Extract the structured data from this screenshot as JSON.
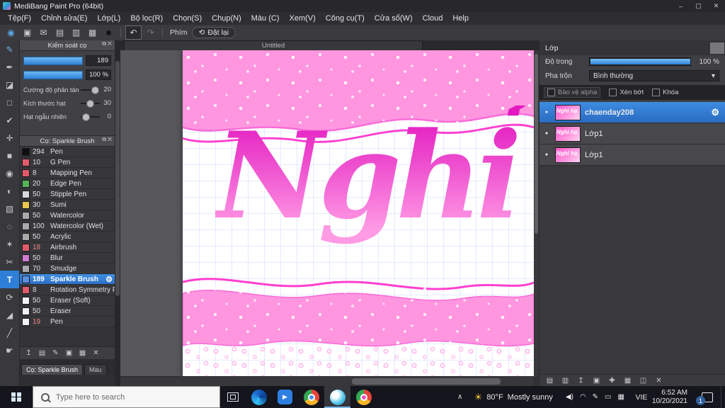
{
  "titlebar": {
    "title": "MediBang Paint Pro (64bit)"
  },
  "window": {
    "min": "–",
    "max": "▢",
    "close": "✕"
  },
  "menubar": {
    "items": [
      "Tệp(F)",
      "Chỉnh sửa(E)",
      "Lớp(L)",
      "Bộ lọc(R)",
      "Chọn(S)",
      "Chụp(N)",
      "Màu (C)",
      "Xem(V)",
      "Công cụ(T)",
      "Cửa sổ(W)",
      "Cloud",
      "Help"
    ]
  },
  "toolbar": {
    "phim": "Phím",
    "dat_lai": "Đặt lại",
    "icons": [
      {
        "name": "brush-preset-icon",
        "glyph": "◉"
      },
      {
        "name": "save-icon",
        "glyph": "▣"
      },
      {
        "name": "comment-icon",
        "glyph": "✉"
      },
      {
        "name": "copy-icon",
        "glyph": "▤"
      },
      {
        "name": "document-icon",
        "glyph": "▥"
      },
      {
        "name": "grid-icon",
        "glyph": "▦"
      },
      {
        "name": "swatch-icon",
        "glyph": "■"
      }
    ]
  },
  "icons": {
    "gear": "⚙",
    "undo": "↶",
    "redo": "↷",
    "reset": "⟲",
    "chevron_up": "∧",
    "sun": "☀",
    "dot": "●"
  },
  "tools": {
    "items": [
      {
        "name": "brush-tool",
        "glyph": "✎"
      },
      {
        "name": "pen-tool",
        "glyph": "✒"
      },
      {
        "name": "eraser-tool",
        "glyph": "◪"
      },
      {
        "name": "marquee-tool",
        "glyph": "□"
      },
      {
        "name": "apply-tool",
        "glyph": "✔"
      },
      {
        "name": "move-tool",
        "glyph": "✛"
      },
      {
        "name": "shape-tool",
        "glyph": "■"
      },
      {
        "name": "bucket-tool",
        "glyph": "◉"
      },
      {
        "name": "gradient-tool",
        "glyph": "◐"
      },
      {
        "name": "select-rect-tool",
        "glyph": "▧"
      },
      {
        "name": "lasso-tool",
        "glyph": "◌"
      },
      {
        "name": "magic-wand-tool",
        "glyph": "✶"
      },
      {
        "name": "scissors-tool",
        "glyph": "✂"
      },
      {
        "name": "text-tool",
        "glyph": "T"
      },
      {
        "name": "rotate-tool",
        "glyph": "⟳"
      },
      {
        "name": "eyedropper-tool",
        "glyph": "◢"
      },
      {
        "name": "divide-tool",
        "glyph": "╱"
      },
      {
        "name": "hand-tool",
        "glyph": "☛"
      }
    ]
  },
  "brush_control": {
    "title": "Kiểm soát cọ",
    "size": "189",
    "opacity": "100 %",
    "p1_label": "Cường độ phân tán",
    "p1_value": "20",
    "p2_label": "Kích thước hạt",
    "p2_value": "30",
    "p3_label": "Hạt ngẫu nhiên",
    "p3_value": "0"
  },
  "brush_panel": {
    "title": "Cọ: Sparkle Brush",
    "tab_brush": "Cọ: Sparkle Brush",
    "tab_color": "Màu",
    "iconbar": [
      {
        "name": "reorder-brush-icon",
        "glyph": "↥"
      },
      {
        "name": "add-brush-icon",
        "glyph": "▤"
      },
      {
        "name": "edit-brush-icon",
        "glyph": "✎"
      },
      {
        "name": "duplicate-brush-icon",
        "glyph": "▣"
      },
      {
        "name": "brush-folder-icon",
        "glyph": "▦"
      },
      {
        "name": "delete-brush-icon",
        "glyph": "✕"
      }
    ],
    "items": [
      {
        "size": "294",
        "name": "Pen",
        "sw": "#101010"
      },
      {
        "size": "10",
        "name": "G Pen",
        "sw": "#e05a6a"
      },
      {
        "size": "8",
        "name": "Mapping Pen",
        "sw": "#e05a6a"
      },
      {
        "size": "20",
        "name": "Edge Pen",
        "sw": "#57b357"
      },
      {
        "size": "50",
        "name": "Stipple Pen",
        "sw": "#d9d9d9"
      },
      {
        "size": "30",
        "name": "Sumi",
        "sw": "#e6c84f"
      },
      {
        "size": "50",
        "name": "Watercolor",
        "sw": "#a9a9a9"
      },
      {
        "size": "100",
        "name": "Watercolor (Wet)",
        "sw": "#a9a9a9"
      },
      {
        "size": "50",
        "name": "Acrylic",
        "sw": "#a9a9a9"
      },
      {
        "size": "18",
        "name": "Airbrush",
        "sw": "#e05a6a"
      },
      {
        "size": "50",
        "name": "Blur",
        "sw": "#d17bd1"
      },
      {
        "size": "70",
        "name": "Smudge",
        "sw": "#a9a9a9"
      },
      {
        "size": "189",
        "name": "Sparkle Brush",
        "sw": "#5a8fe0"
      },
      {
        "size": "8",
        "name": "Rotation Symmetry Pe",
        "sw": "#e05a6a"
      },
      {
        "size": "50",
        "name": "Eraser (Soft)",
        "sw": "#f2f2f2"
      },
      {
        "size": "50",
        "name": "Eraser",
        "sw": "#f2f2f2"
      },
      {
        "size": "19",
        "name": "Pen",
        "sw": "#f2f2f2"
      }
    ]
  },
  "doc": {
    "tab": "Untitled",
    "artwork_text": "Nghỉ hạ"
  },
  "layers": {
    "title": "Lớp",
    "opacity_label": "Độ trong",
    "opacity_value": "100 %",
    "blend_label": "Pha trộn",
    "blend_value": "Bình thường",
    "cb1": "Bảo vệ alpha",
    "cb2": "Xén bớt",
    "cb3": "Khóa",
    "items": [
      {
        "name": "chaenday208"
      },
      {
        "name": "Lớp1"
      },
      {
        "name": "Lớp1"
      }
    ],
    "iconbar": [
      {
        "name": "new-layer-icon",
        "glyph": "▤"
      },
      {
        "name": "new-folder-icon",
        "glyph": "▥"
      },
      {
        "name": "transfer-layer-icon",
        "glyph": "↥"
      },
      {
        "name": "merge-layer-icon",
        "glyph": "▣"
      },
      {
        "name": "clear-layer-icon",
        "glyph": "✚"
      },
      {
        "name": "material-layer-icon",
        "glyph": "▦"
      },
      {
        "name": "mask-layer-icon",
        "glyph": "◫"
      },
      {
        "name": "delete-layer-icon",
        "glyph": "✕"
      }
    ]
  },
  "taskbar": {
    "search": "Type here to search",
    "temp": "80°F",
    "weather": "Mostly sunny",
    "lang": "VIE",
    "time": "6:52 AM",
    "date": "10/20/2021",
    "badge": "1",
    "tray": [
      {
        "name": "speaker-icon",
        "glyph": "◀)"
      },
      {
        "name": "network-icon",
        "glyph": "◠"
      },
      {
        "name": "pen-icon",
        "glyph": "✎"
      },
      {
        "name": "monitor-icon",
        "glyph": "▭"
      },
      {
        "name": "keyboard-icon",
        "glyph": "▦"
      }
    ]
  }
}
